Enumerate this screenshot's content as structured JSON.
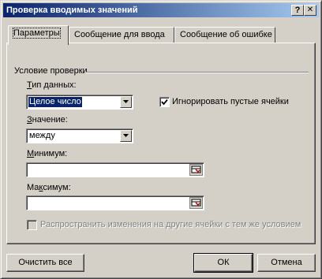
{
  "window": {
    "title": "Проверка вводимых значений"
  },
  "titlebar_buttons": {
    "help": "?",
    "close": "✕"
  },
  "tabs": [
    {
      "label": "Параметры",
      "active": true
    },
    {
      "label": "Сообщение для ввода",
      "active": false
    },
    {
      "label": "Сообщение об ошибке",
      "active": false
    }
  ],
  "validation": {
    "group_label": "Условие проверки",
    "data_type": {
      "label_u": "Т",
      "label_rest": "ип данных:",
      "value": "Целое число"
    },
    "ignore_blank": {
      "label": "Игнорировать пустые ячейки",
      "checked": true
    },
    "operator": {
      "label_u": "З",
      "label_rest": "начение:",
      "value": "между"
    },
    "minimum": {
      "label_u": "М",
      "label_rest": "инимум:",
      "value": ""
    },
    "maximum": {
      "label_pre": "Ма",
      "label_u": "к",
      "label_rest": "симум:",
      "value": ""
    },
    "apply_to_all": {
      "label": "Распространить изменения на другие ячейки с тем же условием",
      "checked": false,
      "enabled": false
    }
  },
  "buttons": {
    "clear_all": "Очистить все",
    "ok": "ОК",
    "cancel": "Отмена"
  },
  "colors": {
    "titlebar_start": "#0a246a",
    "titlebar_end": "#a6caf0",
    "face": "#d4d0c8",
    "selection": "#0a246a"
  }
}
